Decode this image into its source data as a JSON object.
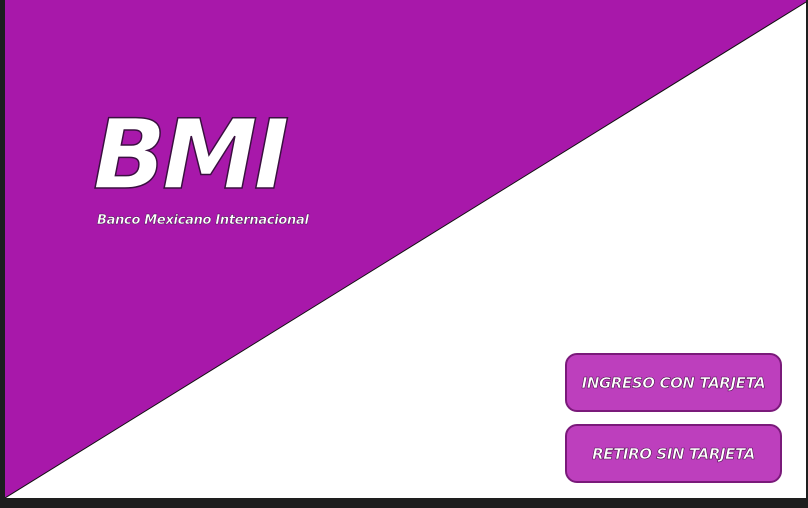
{
  "brand": {
    "title": "BMI",
    "subtitle": "Banco Mexicano Internacional",
    "primary_color": "#a818aa",
    "background_color": "#ffffff"
  },
  "actions": {
    "card_login_label": "INGRESO CON TARJETA",
    "cardless_withdraw_label": "RETIRO SIN TARJETA",
    "button_color": "#bd3fbd"
  }
}
